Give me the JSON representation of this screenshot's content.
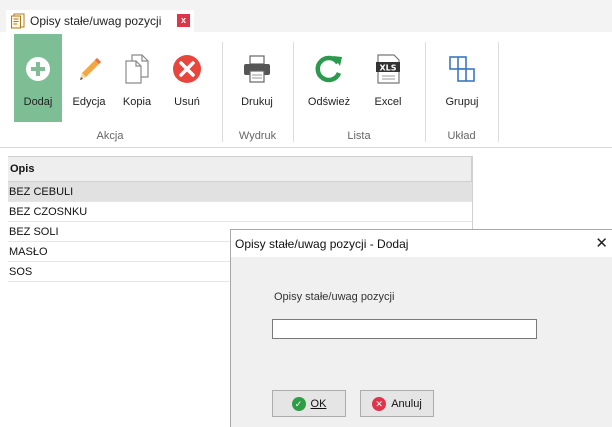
{
  "tab": {
    "title": "Opisy stałe/uwag pozycji",
    "close": "x"
  },
  "ribbon": {
    "buttons": [
      {
        "label": "Dodaj",
        "icon": "plus-circle-icon",
        "active": true
      },
      {
        "label": "Edycja",
        "icon": "pencil-icon"
      },
      {
        "label": "Kopia",
        "icon": "copy-icon"
      },
      {
        "label": "Usuń",
        "icon": "delete-circle-icon"
      },
      {
        "label": "Drukuj",
        "icon": "printer-icon"
      },
      {
        "label": "Odśwież",
        "icon": "refresh-icon"
      },
      {
        "label": "Excel",
        "icon": "excel-xls-icon"
      },
      {
        "label": "Grupuj",
        "icon": "group-icon"
      }
    ],
    "groups": [
      {
        "label": "Akcja"
      },
      {
        "label": "Wydruk"
      },
      {
        "label": "Lista"
      },
      {
        "label": "Układ"
      }
    ],
    "excel_badge": "XLS"
  },
  "list": {
    "header": "Opis",
    "rows": [
      "BEZ CEBULI",
      "BEZ CZOSNKU",
      "BEZ SOLI",
      "MASŁO",
      "SOS"
    ],
    "selected_index": 0
  },
  "dialog": {
    "title": "Opisy stałe/uwag pozycji - Dodaj",
    "close": "✕",
    "field_label": "Opisy stałe/uwag pozycji",
    "field_value": "",
    "ok_label": "OK",
    "cancel_label": "Anuluj"
  },
  "colors": {
    "active_button": "#7dbe94",
    "tab_close": "#e0344a",
    "ok_icon": "#2e9e46",
    "cancel_icon": "#e0344a",
    "refresh": "#2b9a4e",
    "delete": "#e8453c",
    "group_icon": "#3a78c2"
  }
}
